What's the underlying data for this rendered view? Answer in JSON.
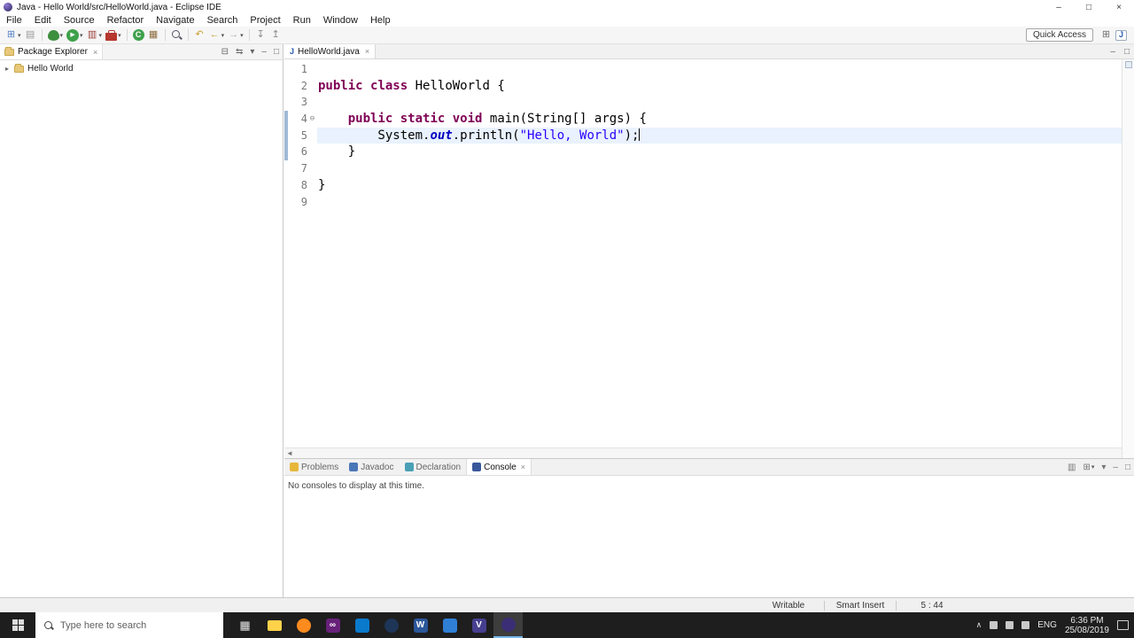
{
  "colors": {
    "keyword": "#7f0055",
    "string": "#2a00ff",
    "field": "#0000c0",
    "current_line": "#e9f2fe",
    "line_number": "#787878"
  },
  "icons": {
    "window-minimize": "–",
    "window-maximize": "□",
    "window-close": "×",
    "chevron-down": "▾",
    "tab-close": "×",
    "view-close": "×",
    "java-file": "J",
    "tree-expander": "▸",
    "fold-marker": "⊖",
    "hscroll-left": "◄",
    "collapse-all": "⊟",
    "link-with-editor": "⇆",
    "view-menu": "▾",
    "minimize-view": "–",
    "maximize-view": "□",
    "tray-chevron": "∧"
  },
  "titlebar": {
    "title": "Java - Hello World/src/HelloWorld.java - Eclipse IDE"
  },
  "menubar": {
    "items": [
      "File",
      "Edit",
      "Source",
      "Refactor",
      "Navigate",
      "Search",
      "Project",
      "Run",
      "Window",
      "Help"
    ]
  },
  "toolbar": {
    "quick_access_label": "Quick Access",
    "icons": [
      {
        "name": "new-icon",
        "glyph": "⊞",
        "color": "#5b87c5",
        "dropdown": true
      },
      {
        "name": "save-icon",
        "glyph": "▤",
        "color": "#9a9a9a"
      },
      {
        "sep": true
      },
      {
        "name": "debug-icon",
        "cls": "ic-bug",
        "dropdown": true
      },
      {
        "name": "run-icon",
        "cls": "ic-run",
        "glyph": "▶",
        "dropdown": true
      },
      {
        "name": "coverage-icon",
        "glyph": "▥",
        "color": "#9a3b35",
        "dropdown": true
      },
      {
        "name": "external-tools-icon",
        "cls": "ic-toolbox",
        "dropdown": true
      },
      {
        "sep": true
      },
      {
        "name": "new-java-class-icon",
        "cls": "ic-class",
        "glyph": "C"
      },
      {
        "name": "new-java-package-icon",
        "glyph": "▦",
        "color": "#8d6e3f"
      },
      {
        "sep": true
      },
      {
        "name": "search-icon",
        "cls": "ic-search"
      },
      {
        "sep": true
      },
      {
        "name": "last-edit-location-icon",
        "glyph": "↶",
        "color": "#c8a030"
      },
      {
        "name": "back-icon",
        "glyph": "←",
        "color": "#c8a030",
        "dropdown": true
      },
      {
        "name": "forward-icon",
        "glyph": "→",
        "color": "#b0b0b0",
        "dropdown": true
      },
      {
        "sep": true
      },
      {
        "name": "next-annotation-icon",
        "glyph": "↧",
        "color": "#8a8a8a"
      },
      {
        "name": "previous-annotation-icon",
        "glyph": "↥",
        "color": "#8a8a8a"
      }
    ],
    "right_icons": [
      {
        "name": "open-perspective-icon",
        "glyph": "⊞",
        "color": "#777"
      },
      {
        "name": "java-perspective-icon",
        "cls": "ic-java",
        "glyph": "J"
      }
    ]
  },
  "package_explorer": {
    "title": "Package Explorer",
    "project_label": "Hello World",
    "actions": [
      {
        "name": "collapse-all-icon",
        "icon": "collapse-all"
      },
      {
        "name": "link-with-editor-icon",
        "icon": "link-with-editor"
      },
      {
        "name": "view-menu-icon",
        "icon": "view-menu"
      },
      {
        "name": "minimize-view-icon",
        "icon": "minimize-view"
      },
      {
        "name": "maximize-view-icon",
        "icon": "maximize-view"
      }
    ]
  },
  "editor": {
    "tab_label": "HelloWorld.java",
    "code_lines": [
      {
        "n": "1",
        "segs": []
      },
      {
        "n": "2",
        "segs": [
          {
            "c": "kw",
            "t": "public"
          },
          {
            "c": "pl",
            "t": " "
          },
          {
            "c": "kw",
            "t": "class"
          },
          {
            "c": "pl",
            "t": " HelloWorld {"
          }
        ]
      },
      {
        "n": "3",
        "segs": []
      },
      {
        "n": "4",
        "fold": true,
        "range": true,
        "segs": [
          {
            "c": "pl",
            "t": "    "
          },
          {
            "c": "kw",
            "t": "public"
          },
          {
            "c": "pl",
            "t": " "
          },
          {
            "c": "kw",
            "t": "static"
          },
          {
            "c": "pl",
            "t": " "
          },
          {
            "c": "kw",
            "t": "void"
          },
          {
            "c": "pl",
            "t": " main(String[] args) {"
          }
        ]
      },
      {
        "n": "5",
        "range": true,
        "current": true,
        "cursor": true,
        "segs": [
          {
            "c": "pl",
            "t": "        System."
          },
          {
            "c": "fld",
            "t": "out"
          },
          {
            "c": "pl",
            "t": ".println("
          },
          {
            "c": "str",
            "t": "\"Hello, World\""
          },
          {
            "c": "pl",
            "t": ");"
          }
        ]
      },
      {
        "n": "6",
        "range": true,
        "segs": [
          {
            "c": "pl",
            "t": "    }"
          }
        ]
      },
      {
        "n": "7",
        "segs": []
      },
      {
        "n": "8",
        "segs": [
          {
            "c": "pl",
            "t": "}"
          }
        ]
      },
      {
        "n": "9",
        "segs": []
      }
    ]
  },
  "console_panel": {
    "tabs": [
      {
        "label": "Problems",
        "name": "tab-problems",
        "color": "#e8b73a",
        "active": false
      },
      {
        "label": "Javadoc",
        "name": "tab-javadoc",
        "color": "#4a77b8",
        "active": false
      },
      {
        "label": "Declaration",
        "name": "tab-declaration",
        "color": "#49a0b5",
        "active": false
      },
      {
        "label": "Console",
        "name": "tab-console",
        "color": "#39589c",
        "active": true
      }
    ],
    "actions": [
      {
        "name": "display-selected-console-icon",
        "glyph": "▥"
      },
      {
        "name": "open-console-icon",
        "glyph": "⊞",
        "dropdown": true
      },
      {
        "name": "view-menu-icon",
        "glyph": "▾"
      },
      {
        "name": "minimize-view-icon",
        "glyph": "–"
      },
      {
        "name": "maximize-view-icon",
        "glyph": "□"
      }
    ],
    "message": "No consoles to display at this time."
  },
  "statusbar": {
    "writable": "Writable",
    "insert_mode": "Smart Insert",
    "cursor_position": "5 : 44"
  },
  "taskbar": {
    "search_placeholder": "Type here to search",
    "apps": [
      {
        "name": "task-view-icon",
        "glyph": "▦",
        "shape": "none",
        "fg": "#e8e8e8"
      },
      {
        "name": "file-explorer-icon",
        "bg": "#ffd24a",
        "shape": "folder"
      },
      {
        "name": "firefox-icon",
        "bg": "#ff8b1f",
        "shape": "circle"
      },
      {
        "name": "visual-studio-icon",
        "bg": "#68217a",
        "glyph": "∞",
        "shape": "square"
      },
      {
        "name": "vscode-icon",
        "bg": "#0a7acc",
        "shape": "square"
      },
      {
        "name": "app-icon-dark",
        "bg": "#1d3557",
        "shape": "circle"
      },
      {
        "name": "word-icon",
        "bg": "#2b579a",
        "glyph": "W",
        "shape": "square"
      },
      {
        "name": "app-icon-blue",
        "bg": "#2f7fd6",
        "shape": "square"
      },
      {
        "name": "v-app-icon",
        "bg": "#463f8f",
        "glyph": "V",
        "shape": "square"
      },
      {
        "name": "eclipse-icon",
        "bg": "#3b2e74",
        "shape": "circle",
        "active": true
      }
    ],
    "tray_language": "ENG",
    "tray_time": "6:36 PM",
    "tray_date": "25/08/2019"
  }
}
